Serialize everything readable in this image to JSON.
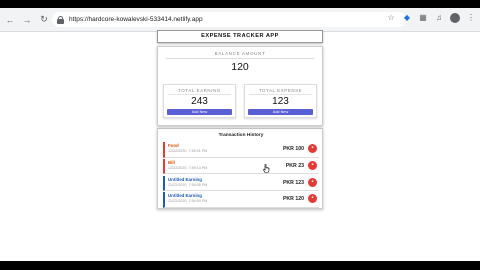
{
  "browser": {
    "url": "https://hardcore-kowalevski-533414.netlify.app",
    "back_icon": "back-arrow-icon",
    "forward_icon": "forward-arrow-icon",
    "reload_icon": "reload-icon"
  },
  "app": {
    "title": "EXPENSE TRACKER APP",
    "balance": {
      "label": "BALANCE AMOUNT",
      "value": "120"
    },
    "earning": {
      "label": "TOTAL EARNING",
      "value": "243",
      "button": "Add New"
    },
    "expense": {
      "label": "TOTAL EXPENSE",
      "value": "123",
      "button": "Add New"
    },
    "history": {
      "title": "Transaction History",
      "items": [
        {
          "name": "Food",
          "date": "12/22/2020, 7:59:21 PM",
          "amount": "PKR 100",
          "kind": "expense"
        },
        {
          "name": "Bill",
          "date": "12/22/2020, 7:59:14 PM",
          "amount": "PKR 23",
          "kind": "expense"
        },
        {
          "name": "Untitled Earning",
          "date": "12/22/2020, 7:54:05 PM",
          "amount": "PKR 123",
          "kind": "earning"
        },
        {
          "name": "Untitled Earning",
          "date": "12/22/2020, 7:54:04 PM",
          "amount": "PKR 120",
          "kind": "earning"
        }
      ]
    }
  },
  "colors": {
    "accent": "#5b5fd6",
    "expense": "#e53935",
    "earning": "#1e5bb8"
  }
}
